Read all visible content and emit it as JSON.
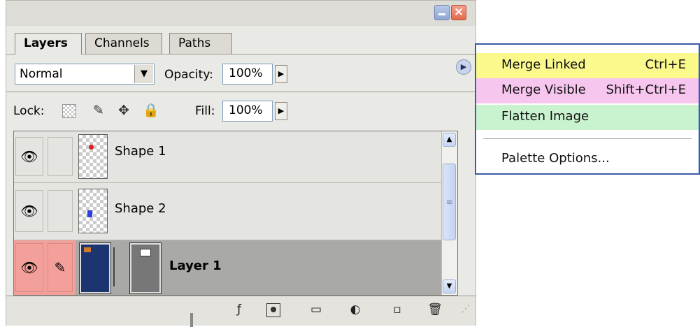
{
  "tabs": [
    {
      "label": "Layers"
    },
    {
      "label": "Channels"
    },
    {
      "label": "Paths"
    }
  ],
  "controls": {
    "blend_mode": "Normal",
    "opacity_label": "Opacity:",
    "opacity_value": "100%",
    "lock_label": "Lock:",
    "fill_label": "Fill:",
    "fill_value": "100%"
  },
  "layers": [
    {
      "name": "Shape 1",
      "visible": true,
      "dot_color": "#e02020"
    },
    {
      "name": "Shape 2",
      "visible": true,
      "dot_color": "#2a3fe0"
    },
    {
      "name": "Layer 1",
      "visible": true,
      "selected": true,
      "row_color": "#f4a09a",
      "thumb_color": "#1c3570"
    }
  ],
  "menu": {
    "items": [
      {
        "label": "Merge Linked",
        "shortcut": "Ctrl+E",
        "bg": "#fbf88c"
      },
      {
        "label": "Merge Visible",
        "shortcut": "Shift+Ctrl+E",
        "bg": "#f6c6ee"
      },
      {
        "label": "Flatten Image",
        "shortcut": "",
        "bg": "#c9f2cf"
      },
      {
        "label": "Palette Options...",
        "shortcut": "",
        "bg": "#ffffff"
      }
    ]
  },
  "bottom_icons": [
    "layer-style-icon",
    "add-mask-icon",
    "new-group-icon",
    "adjustment-layer-icon",
    "new-layer-icon",
    "trash-icon"
  ]
}
